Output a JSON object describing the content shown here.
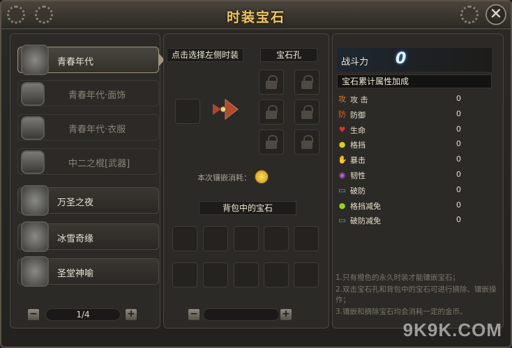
{
  "window": {
    "title": "时装宝石"
  },
  "costumes": [
    {
      "label": "青春年代",
      "state": "active"
    },
    {
      "label": "青春年代·面饰",
      "state": "locked"
    },
    {
      "label": "青春年代·衣服",
      "state": "locked"
    },
    {
      "label": "中二之棍[武器]",
      "state": "locked"
    },
    {
      "label": "万圣之夜",
      "state": "normal"
    },
    {
      "label": "冰雪奇缘",
      "state": "normal"
    },
    {
      "label": "圣堂神喻",
      "state": "normal"
    }
  ],
  "left_pager": {
    "page": "1/4",
    "minus": "−",
    "plus": "+"
  },
  "middle": {
    "select_hint": "点击选择左侧时装",
    "gem_slots_header": "宝石孔",
    "inlay_cost_label": "本次镶嵌消耗：",
    "backpack_header": "背包中的宝石"
  },
  "mid_pager": {
    "minus": "−",
    "plus": "+"
  },
  "right": {
    "power_label": "战斗力",
    "power_value": "0",
    "cumulative_header": "宝石累计属性加成",
    "attributes": [
      {
        "icon": "攻",
        "name": "攻 击",
        "value": "0",
        "color": "#e07a2a"
      },
      {
        "icon": "防",
        "name": "防御",
        "value": "0",
        "color": "#e05a2a"
      },
      {
        "icon": "♥",
        "name": "生命",
        "value": "0",
        "color": "#e03030"
      },
      {
        "icon": "●",
        "name": "格挡",
        "value": "0",
        "color": "#d8d020"
      },
      {
        "icon": "✋",
        "name": "暴击",
        "value": "0",
        "color": "#e08040"
      },
      {
        "icon": "◉",
        "name": "韧性",
        "value": "0",
        "color": "#c060e0"
      },
      {
        "icon": "▭",
        "name": "破防",
        "value": "0",
        "color": "#40c0a0"
      },
      {
        "icon": "●",
        "name": "格挡减免",
        "value": "0",
        "color": "#a0d020"
      },
      {
        "icon": "▭",
        "name": "破防减免",
        "value": "0",
        "color": "#40b0c0"
      }
    ],
    "notes": [
      "1.只有橙色的永久时装才能镶嵌宝石；",
      "2.双击宝石孔和背包中的宝石可进行摘除、镶嵌操作；",
      "3.镶嵌和摘除宝石均会消耗一定的金币。"
    ]
  },
  "watermark": "9K9K.COM"
}
